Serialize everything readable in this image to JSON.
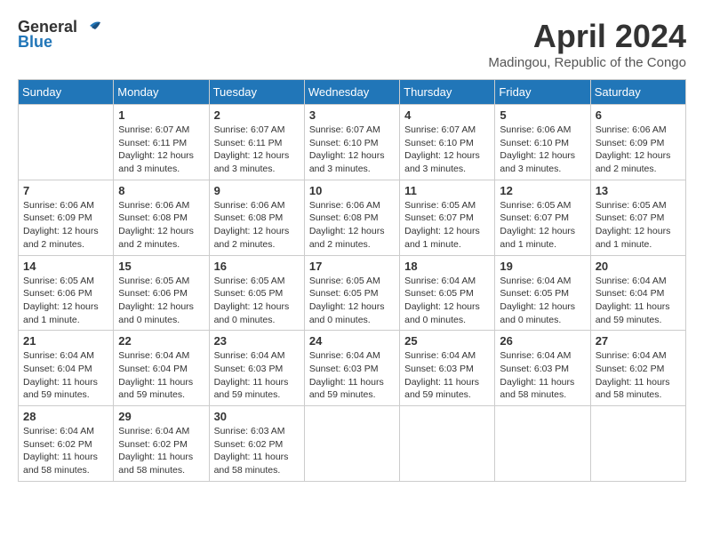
{
  "logo": {
    "line1": "General",
    "line2": "Blue"
  },
  "title": "April 2024",
  "subtitle": "Madingou, Republic of the Congo",
  "days_of_week": [
    "Sunday",
    "Monday",
    "Tuesday",
    "Wednesday",
    "Thursday",
    "Friday",
    "Saturday"
  ],
  "weeks": [
    [
      {
        "day": "",
        "sunrise": "",
        "sunset": "",
        "daylight": ""
      },
      {
        "day": "1",
        "sunrise": "Sunrise: 6:07 AM",
        "sunset": "Sunset: 6:11 PM",
        "daylight": "Daylight: 12 hours and 3 minutes."
      },
      {
        "day": "2",
        "sunrise": "Sunrise: 6:07 AM",
        "sunset": "Sunset: 6:11 PM",
        "daylight": "Daylight: 12 hours and 3 minutes."
      },
      {
        "day": "3",
        "sunrise": "Sunrise: 6:07 AM",
        "sunset": "Sunset: 6:10 PM",
        "daylight": "Daylight: 12 hours and 3 minutes."
      },
      {
        "day": "4",
        "sunrise": "Sunrise: 6:07 AM",
        "sunset": "Sunset: 6:10 PM",
        "daylight": "Daylight: 12 hours and 3 minutes."
      },
      {
        "day": "5",
        "sunrise": "Sunrise: 6:06 AM",
        "sunset": "Sunset: 6:10 PM",
        "daylight": "Daylight: 12 hours and 3 minutes."
      },
      {
        "day": "6",
        "sunrise": "Sunrise: 6:06 AM",
        "sunset": "Sunset: 6:09 PM",
        "daylight": "Daylight: 12 hours and 2 minutes."
      }
    ],
    [
      {
        "day": "7",
        "sunrise": "Sunrise: 6:06 AM",
        "sunset": "Sunset: 6:09 PM",
        "daylight": "Daylight: 12 hours and 2 minutes."
      },
      {
        "day": "8",
        "sunrise": "Sunrise: 6:06 AM",
        "sunset": "Sunset: 6:08 PM",
        "daylight": "Daylight: 12 hours and 2 minutes."
      },
      {
        "day": "9",
        "sunrise": "Sunrise: 6:06 AM",
        "sunset": "Sunset: 6:08 PM",
        "daylight": "Daylight: 12 hours and 2 minutes."
      },
      {
        "day": "10",
        "sunrise": "Sunrise: 6:06 AM",
        "sunset": "Sunset: 6:08 PM",
        "daylight": "Daylight: 12 hours and 2 minutes."
      },
      {
        "day": "11",
        "sunrise": "Sunrise: 6:05 AM",
        "sunset": "Sunset: 6:07 PM",
        "daylight": "Daylight: 12 hours and 1 minute."
      },
      {
        "day": "12",
        "sunrise": "Sunrise: 6:05 AM",
        "sunset": "Sunset: 6:07 PM",
        "daylight": "Daylight: 12 hours and 1 minute."
      },
      {
        "day": "13",
        "sunrise": "Sunrise: 6:05 AM",
        "sunset": "Sunset: 6:07 PM",
        "daylight": "Daylight: 12 hours and 1 minute."
      }
    ],
    [
      {
        "day": "14",
        "sunrise": "Sunrise: 6:05 AM",
        "sunset": "Sunset: 6:06 PM",
        "daylight": "Daylight: 12 hours and 1 minute."
      },
      {
        "day": "15",
        "sunrise": "Sunrise: 6:05 AM",
        "sunset": "Sunset: 6:06 PM",
        "daylight": "Daylight: 12 hours and 0 minutes."
      },
      {
        "day": "16",
        "sunrise": "Sunrise: 6:05 AM",
        "sunset": "Sunset: 6:05 PM",
        "daylight": "Daylight: 12 hours and 0 minutes."
      },
      {
        "day": "17",
        "sunrise": "Sunrise: 6:05 AM",
        "sunset": "Sunset: 6:05 PM",
        "daylight": "Daylight: 12 hours and 0 minutes."
      },
      {
        "day": "18",
        "sunrise": "Sunrise: 6:04 AM",
        "sunset": "Sunset: 6:05 PM",
        "daylight": "Daylight: 12 hours and 0 minutes."
      },
      {
        "day": "19",
        "sunrise": "Sunrise: 6:04 AM",
        "sunset": "Sunset: 6:05 PM",
        "daylight": "Daylight: 12 hours and 0 minutes."
      },
      {
        "day": "20",
        "sunrise": "Sunrise: 6:04 AM",
        "sunset": "Sunset: 6:04 PM",
        "daylight": "Daylight: 11 hours and 59 minutes."
      }
    ],
    [
      {
        "day": "21",
        "sunrise": "Sunrise: 6:04 AM",
        "sunset": "Sunset: 6:04 PM",
        "daylight": "Daylight: 11 hours and 59 minutes."
      },
      {
        "day": "22",
        "sunrise": "Sunrise: 6:04 AM",
        "sunset": "Sunset: 6:04 PM",
        "daylight": "Daylight: 11 hours and 59 minutes."
      },
      {
        "day": "23",
        "sunrise": "Sunrise: 6:04 AM",
        "sunset": "Sunset: 6:03 PM",
        "daylight": "Daylight: 11 hours and 59 minutes."
      },
      {
        "day": "24",
        "sunrise": "Sunrise: 6:04 AM",
        "sunset": "Sunset: 6:03 PM",
        "daylight": "Daylight: 11 hours and 59 minutes."
      },
      {
        "day": "25",
        "sunrise": "Sunrise: 6:04 AM",
        "sunset": "Sunset: 6:03 PM",
        "daylight": "Daylight: 11 hours and 59 minutes."
      },
      {
        "day": "26",
        "sunrise": "Sunrise: 6:04 AM",
        "sunset": "Sunset: 6:03 PM",
        "daylight": "Daylight: 11 hours and 58 minutes."
      },
      {
        "day": "27",
        "sunrise": "Sunrise: 6:04 AM",
        "sunset": "Sunset: 6:02 PM",
        "daylight": "Daylight: 11 hours and 58 minutes."
      }
    ],
    [
      {
        "day": "28",
        "sunrise": "Sunrise: 6:04 AM",
        "sunset": "Sunset: 6:02 PM",
        "daylight": "Daylight: 11 hours and 58 minutes."
      },
      {
        "day": "29",
        "sunrise": "Sunrise: 6:04 AM",
        "sunset": "Sunset: 6:02 PM",
        "daylight": "Daylight: 11 hours and 58 minutes."
      },
      {
        "day": "30",
        "sunrise": "Sunrise: 6:03 AM",
        "sunset": "Sunset: 6:02 PM",
        "daylight": "Daylight: 11 hours and 58 minutes."
      },
      {
        "day": "",
        "sunrise": "",
        "sunset": "",
        "daylight": ""
      },
      {
        "day": "",
        "sunrise": "",
        "sunset": "",
        "daylight": ""
      },
      {
        "day": "",
        "sunrise": "",
        "sunset": "",
        "daylight": ""
      },
      {
        "day": "",
        "sunrise": "",
        "sunset": "",
        "daylight": ""
      }
    ]
  ]
}
